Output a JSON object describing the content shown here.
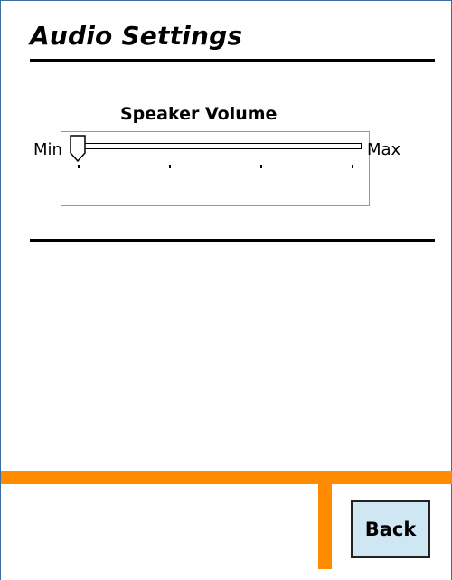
{
  "header": {
    "title": "Audio Settings"
  },
  "speaker_volume": {
    "label": "Speaker Volume",
    "min_label": "Min",
    "max_label": "Max",
    "value_fraction": 0.0,
    "tick_count": 4
  },
  "footer": {
    "back_label": "Back"
  },
  "colors": {
    "accent": "#ff8c00",
    "focus_border": "#49b8cc",
    "button_bg": "#cfe6f3"
  }
}
